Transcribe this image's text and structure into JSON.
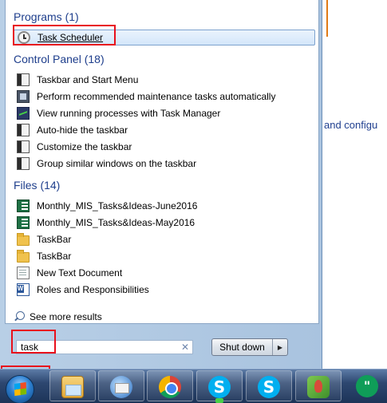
{
  "background_doc": {
    "text": "and configu"
  },
  "start_menu": {
    "programs": {
      "title": "Programs (1)",
      "items": [
        {
          "label": "Task Scheduler",
          "icon": "clock-icon"
        }
      ]
    },
    "control_panel": {
      "title": "Control Panel (18)",
      "items": [
        {
          "label": "Taskbar and Start Menu",
          "icon": "taskbar-icon"
        },
        {
          "label": "Perform recommended maintenance tasks automatically",
          "icon": "maintenance-icon"
        },
        {
          "label": "View running processes with Task Manager",
          "icon": "task-manager-icon"
        },
        {
          "label": "Auto-hide the taskbar",
          "icon": "taskbar-icon"
        },
        {
          "label": "Customize the taskbar",
          "icon": "taskbar-icon"
        },
        {
          "label": "Group similar windows on the taskbar",
          "icon": "taskbar-icon"
        }
      ]
    },
    "files": {
      "title": "Files (14)",
      "items": [
        {
          "label": "Monthly_MIS_Tasks&Ideas-June2016",
          "icon": "excel-icon"
        },
        {
          "label": "Monthly_MIS_Tasks&Ideas-May2016",
          "icon": "excel-icon"
        },
        {
          "label": "TaskBar",
          "icon": "folder-icon"
        },
        {
          "label": "TaskBar",
          "icon": "folder-icon"
        },
        {
          "label": "New Text Document",
          "icon": "text-document-icon"
        },
        {
          "label": "Roles and Responsibilities",
          "icon": "word-icon"
        }
      ]
    },
    "see_more": "See more results",
    "search": {
      "value": "task",
      "clear_symbol": "✕"
    },
    "shutdown": {
      "label": "Shut down",
      "arrow": "▶"
    }
  },
  "taskbar": {
    "pinned": [
      "start-orb",
      "windows-explorer-icon",
      "thunderbird-icon",
      "chrome-icon",
      "skype-icon",
      "skype-icon",
      "parrot-app-icon",
      "hangouts-icon"
    ],
    "skype_glyph": "S",
    "hangouts_glyph": "\""
  },
  "colors": {
    "group_title": "#1e3e8c",
    "highlight": "#e8101c",
    "taskbar": "#2d4770",
    "menu_frame": "#a9c3df"
  }
}
